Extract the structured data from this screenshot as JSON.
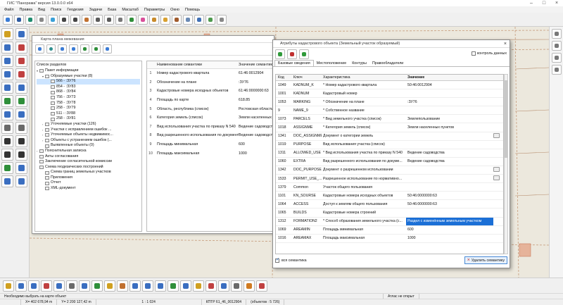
{
  "window": {
    "title": "ГИС \"Панорама\" версия 13.0.0.0 x64"
  },
  "menu": [
    "Файл",
    "Правка",
    "Вид",
    "Поиск",
    "Геодезия",
    "Задачи",
    "База",
    "Масштаб",
    "Параметры",
    "Окно",
    "Помощь"
  ],
  "map_window": {
    "title": "Карта плана межевания",
    "tree": {
      "header": "Список разделов",
      "items": [
        {
          "level": 0,
          "text": "Пакет информации",
          "tw": "▾"
        },
        {
          "level": 1,
          "text": "Образуемые участки (8)",
          "tw": "▾"
        },
        {
          "level": 2,
          "text": "566 - :ЗУ76",
          "sel": true
        },
        {
          "level": 2,
          "text": "854 - :ЗУ83"
        },
        {
          "level": 2,
          "text": "868 - :ЗУ84"
        },
        {
          "level": 2,
          "text": "756 - :ЗУ73"
        },
        {
          "level": 2,
          "text": "758 - :ЗУ78"
        },
        {
          "level": 2,
          "text": "258 - :ЗУ79"
        },
        {
          "level": 2,
          "text": "511 - :ЗУ88"
        },
        {
          "level": 2,
          "text": "258 - :ЗУ81"
        },
        {
          "level": 1,
          "text": "Уточняемые участки (126)",
          "tw": "›"
        },
        {
          "level": 1,
          "text": "Участки с исправлением ошибок ...",
          "tw": "›"
        },
        {
          "level": 1,
          "text": "Уточняемые объекты недвижимос...",
          "tw": "›"
        },
        {
          "level": 1,
          "text": "Объекты с устранением ошибок (...",
          "tw": "›"
        },
        {
          "level": 1,
          "text": "Выявленные объекты (0)"
        },
        {
          "level": 0,
          "text": "Пояснительная записка",
          "tw": "›"
        },
        {
          "level": 0,
          "text": "Акты согласования"
        },
        {
          "level": 0,
          "text": "Заключение согласительной комиссии"
        },
        {
          "level": 0,
          "text": "Схема геодезических построений"
        },
        {
          "level": 1,
          "text": "Схема границ земельных участков"
        },
        {
          "level": 1,
          "text": "Приложения"
        },
        {
          "level": 1,
          "text": "Отчет"
        },
        {
          "level": 1,
          "text": "XML-документ"
        }
      ]
    },
    "semantics": {
      "col_name": "Наименование семантики",
      "col_value": "Значение семантики",
      "rows": [
        {
          "n": "1",
          "name": "Номер кадастрового квартала",
          "value": "61:46:0012904"
        },
        {
          "n": "2",
          "name": "Обозначение на плане",
          "value": ":ЗУ76"
        },
        {
          "n": "3",
          "name": "Кадастровые номера исходных объектов",
          "value": "61:46:0000000:63"
        },
        {
          "n": "4",
          "name": "Площадь по карте",
          "value": "618.85"
        },
        {
          "n": "5",
          "name": "Область, республика (список)",
          "value": "Ростовская область"
        },
        {
          "n": "6",
          "name": "Категория земель (список)",
          "value": "Земли населенных пунктов"
        },
        {
          "n": "7",
          "name": "Вид использования участка по приказу N 540",
          "value": "Ведение садоводства"
        },
        {
          "n": "8",
          "name": "Вид разрешенного использования по документу",
          "value": "Ведение садоводства"
        },
        {
          "n": "9",
          "name": "Площадь минимальная",
          "value": "600"
        },
        {
          "n": "10",
          "name": "Площадь максимальная",
          "value": "1000"
        }
      ]
    }
  },
  "attributes_dialog": {
    "title": "Атрибуты кадастрового объекта (Земельный участок образуемый)",
    "control_label": "контроль данных",
    "tabs": [
      "Базовые сведения",
      "Местоположение",
      "Контуры",
      "Правообладатели"
    ],
    "columns": {
      "code": "Код",
      "key": "Ключ",
      "characteristic": "Характеристика",
      "value": "Значение"
    },
    "rows": [
      {
        "code": "1049",
        "key": "KADNUM_K",
        "char": "* Номер кадастрового квартала",
        "value": "50:46:0012904"
      },
      {
        "code": "1001",
        "key": "KADNUM",
        "char": "Кадастровый номер",
        "value": ""
      },
      {
        "code": "1053",
        "key": "MARKING",
        "char": "* Обозначение на плане",
        "value": ":ЗУ76"
      },
      {
        "code": "9",
        "key": "NAME_9",
        "char": "* Собственное название",
        "value": ""
      },
      {
        "code": "1073",
        "key": "PARCELS",
        "char": "* Вид земельного участка (список)",
        "value": "Землепользование"
      },
      {
        "code": "1018",
        "key": "ASSIGNME",
        "char": "* Категория земель (список)",
        "value": "Земли населенных пунктов"
      },
      {
        "code": "1341",
        "key": "DOC_ASSIGNME",
        "char": "Документ о категории земель",
        "value": "",
        "btn": true
      },
      {
        "code": "1019",
        "key": "PURPOSE",
        "char": "Вид использования участка (список)",
        "value": ""
      },
      {
        "code": "1311",
        "key": "ALLOWED_USE",
        "char": "* Вид использования участка по приказу N 540",
        "value": "Ведение садоводства"
      },
      {
        "code": "1060",
        "key": "EXTRA",
        "char": "Вид разрешенного использования по докуме...",
        "value": "Ведение садоводства"
      },
      {
        "code": "1342",
        "key": "DOC_PURPOSE",
        "char": "Документ о разрешенном использовании",
        "value": "",
        "btn": true
      },
      {
        "code": "1533",
        "key": "PERMIT_USE_...",
        "char": "Разрешенное использование по нормативно...",
        "value": "",
        "btn": true
      },
      {
        "code": "1379",
        "key": "Common",
        "char": "Участок общего пользования",
        "value": ""
      },
      {
        "code": "1101",
        "key": "KN_SOURSE",
        "char": "Кадастровые номера исходных объектов",
        "value": "50:46:0000000:63"
      },
      {
        "code": "1064",
        "key": "ACCESS",
        "char": "Доступ к землям общего пользования",
        "value": "50:46:0000000:63"
      },
      {
        "code": "1065",
        "key": "BUILDS",
        "char": "Кадастровые номера строений",
        "value": ""
      },
      {
        "code": "1312",
        "key": "FORMATION2",
        "char": "* Способ образования земельного участка (с...",
        "value": "Раздел с изменённым земельным участком",
        "hl": true
      },
      {
        "code": "1069",
        "key": "AREAMIN",
        "char": "Площадь минимальная",
        "value": "600"
      },
      {
        "code": "1016",
        "key": "AREAMAX",
        "char": "Площадь максимальная",
        "value": "1000"
      }
    ],
    "footer_checkbox": "вся семантика",
    "delete_button": "Удалить семантику"
  },
  "status": {
    "hint": "Необходимо выбрать на карте объект",
    "atlas": "Атлас не открыт",
    "x": "X= 402 678,94 m",
    "y": "Y= 2 200 127,42 m",
    "scale": "1 : 1 024",
    "map": "КПТР 61_46_0012904",
    "objects": "(объектов : 5 726)"
  }
}
